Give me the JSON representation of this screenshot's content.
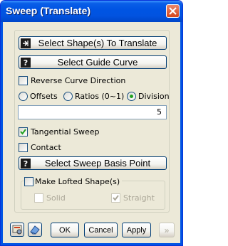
{
  "window": {
    "title": "Sweep (Translate)"
  },
  "buttons": {
    "select_shapes": "Select Shape(s) To Translate",
    "select_guide": "Select Guide Curve",
    "select_basis": "Select Sweep Basis Point"
  },
  "options": {
    "reverse_curve": "Reverse Curve Direction",
    "offsets": "Offsets",
    "ratios": "Ratios (0~1)",
    "division": "Division",
    "selected_mode": "Division",
    "division_value": "5",
    "tangential": "Tangential Sweep",
    "tangential_checked": true,
    "contact": "Contact",
    "contact_checked": false,
    "make_lofted": "Make Lofted Shape(s)",
    "solid": "Solid",
    "straight": "Straight",
    "straight_checked": true
  },
  "footer": {
    "ok": "OK",
    "cancel": "Cancel",
    "apply": "Apply",
    "more": "»"
  },
  "icons": [
    "arrow-select-icon",
    "question-icon",
    "question-icon",
    "question-icon",
    "settings-icon",
    "eraser-icon",
    "close-icon"
  ]
}
